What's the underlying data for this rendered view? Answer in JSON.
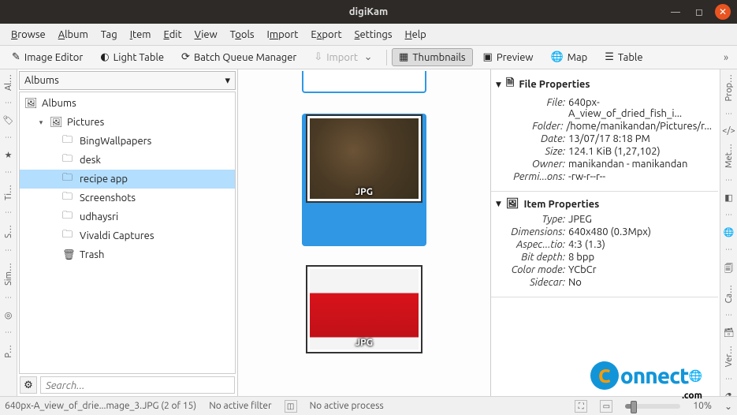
{
  "window": {
    "title": "digiKam"
  },
  "menu": {
    "browse": "Browse",
    "album": "Album",
    "tag": "Tag",
    "item": "Item",
    "edit": "Edit",
    "view": "View",
    "tools": "Tools",
    "import": "Import",
    "export": "Export",
    "settings": "Settings",
    "help": "Help"
  },
  "toolbar": {
    "image_editor": "Image Editor",
    "light_table": "Light Table",
    "batch": "Batch Queue Manager",
    "import": "Import",
    "thumbnails": "Thumbnails",
    "preview": "Preview",
    "map": "Map",
    "table": "Table"
  },
  "left_tabs": [
    "Al…",
    "",
    "",
    "Ti…",
    "S…",
    "Sim…",
    "",
    "P…"
  ],
  "right_tabs": [
    "Prop…",
    "Met…",
    "",
    "",
    "Ca…",
    "Ver…",
    ""
  ],
  "sidebar": {
    "combo": "Albums",
    "root": "Albums",
    "pictures": "Pictures",
    "items": [
      "BingWallpapers",
      "desk",
      "recipe app",
      "Screenshots",
      "udhaysri",
      "Vivaldi Captures",
      "Trash"
    ],
    "selected_index": 2,
    "search_placeholder": "Search..."
  },
  "thumbs": {
    "ext": "JPG"
  },
  "file_properties": {
    "header": "File Properties",
    "rows": [
      {
        "label": "File:",
        "value": "640px-A_view_of_dried_fish_i..."
      },
      {
        "label": "Folder:",
        "value": "/home/manikandan/Pictures/r..."
      },
      {
        "label": "Date:",
        "value": "13/07/17 8:18 PM"
      },
      {
        "label": "Size:",
        "value": "124.1 KiB (1,27,102)"
      },
      {
        "label": "Owner:",
        "value": "manikandan - manikandan"
      },
      {
        "label": "Permi...ons:",
        "value": "-rw-r--r--"
      }
    ]
  },
  "item_properties": {
    "header": "Item Properties",
    "rows": [
      {
        "label": "Type:",
        "value": "JPEG"
      },
      {
        "label": "Dimensions:",
        "value": "640x480 (0.3Mpx)"
      },
      {
        "label": "Aspec...tio:",
        "value": "4:3 (1.3)"
      },
      {
        "label": "Bit depth:",
        "value": "8 bpp"
      },
      {
        "label": "Color mode:",
        "value": "YCbCr"
      },
      {
        "label": "Sidecar:",
        "value": "No"
      }
    ]
  },
  "status": {
    "file": "640px-A_view_of_drie...mage_3.JPG (2 of 15)",
    "filter": "No active filter",
    "process": "No active process",
    "zoom": "10%"
  }
}
